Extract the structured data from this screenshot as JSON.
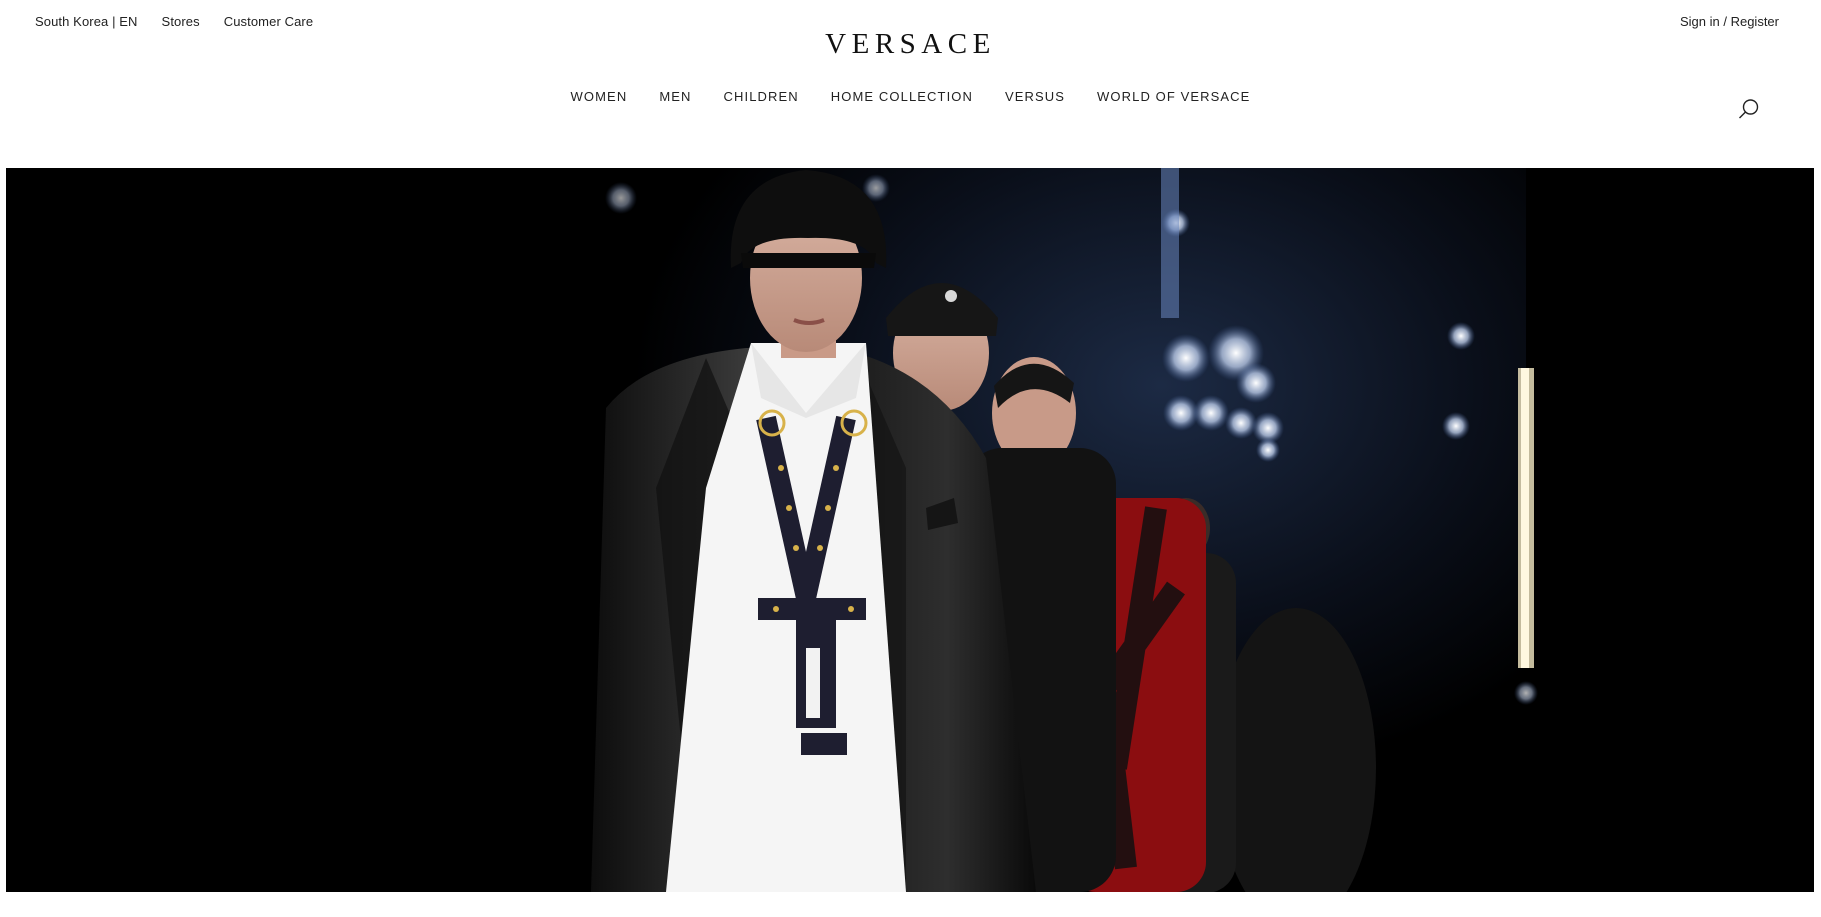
{
  "header": {
    "country": "South Korea | EN",
    "stores": "Stores",
    "customer_care": "Customer Care",
    "account": "Sign in / Register",
    "logo": "VERSACE"
  },
  "nav": {
    "items": [
      "WOMEN",
      "MEN",
      "CHILDREN",
      "HOME COLLECTION",
      "VERSUS",
      "WORLD OF VERSACE"
    ]
  },
  "icons": {
    "search": "search-icon"
  },
  "hero": {
    "alt": "runway-photo"
  }
}
